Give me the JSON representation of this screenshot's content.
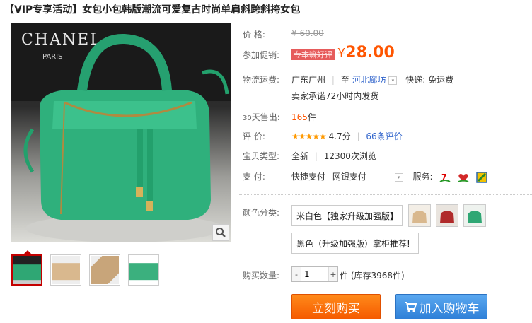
{
  "title": "【VIP专享活动】女包小包韩版潮流可爱复古时尚单肩斜跨斜挎女包",
  "image_text": "CHANEL PARIS",
  "price": {
    "label": "价    格:",
    "value": "¥ 60.00"
  },
  "promo": {
    "label": "参加促销:",
    "tag": "专本嘛好评",
    "currency": "¥",
    "value": "28.00"
  },
  "shipping": {
    "label": "物流运费:",
    "from": "广东广州",
    "to_prefix": "至",
    "to": "河北廊坊",
    "dropdown": "▾",
    "express": "快递: 免运费",
    "promise": "卖家承诺72小时内发货"
  },
  "sales": {
    "label_days": "30",
    "label_rest": "天售出:",
    "count": "165",
    "unit": "件"
  },
  "rating": {
    "label": "评    价:",
    "stars": "★★★★★",
    "score": "4.7分",
    "reviews": "66条评价"
  },
  "item_type": {
    "label": "宝贝类型:",
    "condition": "全新",
    "views": "12300次浏览"
  },
  "payment": {
    "label": "支    付:",
    "methods": [
      "快捷支付",
      "网银支付"
    ],
    "service_label": "服务:",
    "icons": [
      "seven-day-return-icon",
      "heart-guarantee-icon",
      "credit-card-icon"
    ]
  },
  "color": {
    "label": "颜色分类:",
    "options": [
      "米白色【独家升级加强版】",
      "黑色（升级加强版）掌柜推荐!"
    ],
    "swatches": [
      {
        "name": "beige",
        "color": "#d9b88e"
      },
      {
        "name": "red",
        "color": "#b02a2a"
      },
      {
        "name": "green",
        "color": "#2fa774"
      }
    ]
  },
  "quantity": {
    "label": "购买数量:",
    "value": "1",
    "minus": "-",
    "plus": "+",
    "stock": "件 (库存3968件)"
  },
  "buttons": {
    "buy": "立刻购买",
    "cart": "加入购物车"
  },
  "thumbnails": [
    {
      "name": "green-front",
      "color": "#2fa774"
    },
    {
      "name": "beige-front",
      "color": "#d9b88e"
    },
    {
      "name": "beige-open",
      "color": "#c8a57a"
    },
    {
      "name": "green-side",
      "color": "#3bb07e"
    }
  ],
  "colors": {
    "accent": "#ff5500",
    "promo_tag": "#e65b5b",
    "cart_blue": "#2f80d8",
    "active_thumb": "#c40000"
  }
}
